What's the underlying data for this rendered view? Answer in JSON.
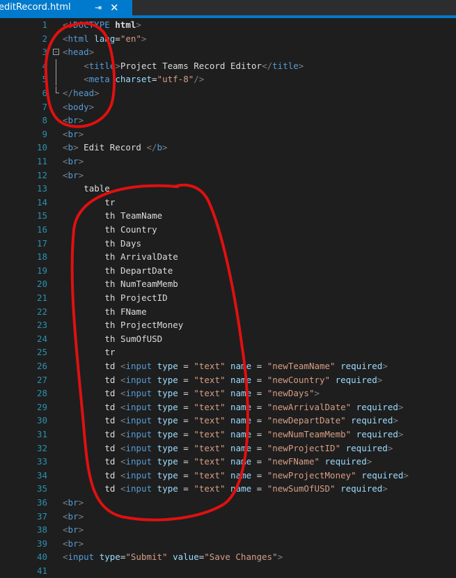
{
  "tab": {
    "title": "editRecord.html",
    "pin": "⇥",
    "close": "✕"
  },
  "lines": [
    {
      "n": "1",
      "indent": 0,
      "parts": [
        {
          "t": "<!",
          "c": "br"
        },
        {
          "t": "DOCTYPE ",
          "c": "tag"
        },
        {
          "t": "html",
          "c": "txt bold"
        },
        {
          "t": ">",
          "c": "br"
        }
      ]
    },
    {
      "n": "2",
      "indent": 0,
      "parts": [
        {
          "t": "<",
          "c": "br"
        },
        {
          "t": "html",
          "c": "tag"
        },
        {
          "t": " lang",
          "c": "attr"
        },
        {
          "t": "=",
          "c": "txt"
        },
        {
          "t": "\"en\"",
          "c": "val"
        },
        {
          "t": ">",
          "c": "br"
        }
      ]
    },
    {
      "n": "3",
      "indent": 0,
      "fold": "minus",
      "parts": [
        {
          "t": "<",
          "c": "br"
        },
        {
          "t": "head",
          "c": "tag"
        },
        {
          "t": ">",
          "c": "br"
        }
      ]
    },
    {
      "n": "4",
      "indent": 4,
      "foldline": true,
      "parts": [
        {
          "t": "<",
          "c": "br"
        },
        {
          "t": "title",
          "c": "tag"
        },
        {
          "t": ">",
          "c": "br"
        },
        {
          "t": "Project Teams Record Editor",
          "c": "txt"
        },
        {
          "t": "</",
          "c": "br"
        },
        {
          "t": "title",
          "c": "tag"
        },
        {
          "t": ">",
          "c": "br"
        }
      ]
    },
    {
      "n": "5",
      "indent": 4,
      "foldline": true,
      "parts": [
        {
          "t": "<",
          "c": "br"
        },
        {
          "t": "meta",
          "c": "tag"
        },
        {
          "t": " charset",
          "c": "attr"
        },
        {
          "t": "=",
          "c": "txt"
        },
        {
          "t": "\"utf-8\"",
          "c": "val"
        },
        {
          "t": "/>",
          "c": "br"
        }
      ]
    },
    {
      "n": "6",
      "indent": 0,
      "foldend": true,
      "parts": [
        {
          "t": "</",
          "c": "br"
        },
        {
          "t": "head",
          "c": "tag"
        },
        {
          "t": ">",
          "c": "br"
        }
      ]
    },
    {
      "n": "7",
      "indent": 0,
      "parts": [
        {
          "t": "<",
          "c": "br"
        },
        {
          "t": "body",
          "c": "tag"
        },
        {
          "t": ">",
          "c": "br"
        }
      ]
    },
    {
      "n": "8",
      "indent": 0,
      "parts": [
        {
          "t": "<",
          "c": "br"
        },
        {
          "t": "br",
          "c": "tag"
        },
        {
          "t": ">",
          "c": "br"
        }
      ]
    },
    {
      "n": "9",
      "indent": 0,
      "parts": [
        {
          "t": "<",
          "c": "br"
        },
        {
          "t": "br",
          "c": "tag"
        },
        {
          "t": ">",
          "c": "br"
        }
      ]
    },
    {
      "n": "10",
      "indent": 0,
      "parts": [
        {
          "t": "<",
          "c": "br"
        },
        {
          "t": "b",
          "c": "tag"
        },
        {
          "t": ">",
          "c": "br"
        },
        {
          "t": " Edit Record ",
          "c": "txt"
        },
        {
          "t": "</",
          "c": "br"
        },
        {
          "t": "b",
          "c": "tag"
        },
        {
          "t": ">",
          "c": "br"
        }
      ]
    },
    {
      "n": "11",
      "indent": 0,
      "parts": [
        {
          "t": "<",
          "c": "br"
        },
        {
          "t": "br",
          "c": "tag"
        },
        {
          "t": ">",
          "c": "br"
        }
      ]
    },
    {
      "n": "12",
      "indent": 0,
      "parts": [
        {
          "t": "<",
          "c": "br"
        },
        {
          "t": "br",
          "c": "tag"
        },
        {
          "t": ">",
          "c": "br"
        }
      ]
    },
    {
      "n": "13",
      "indent": 4,
      "parts": [
        {
          "t": "table",
          "c": "txt"
        }
      ]
    },
    {
      "n": "14",
      "indent": 8,
      "parts": [
        {
          "t": "tr",
          "c": "txt"
        }
      ]
    },
    {
      "n": "15",
      "indent": 8,
      "parts": [
        {
          "t": "th TeamName",
          "c": "txt"
        }
      ]
    },
    {
      "n": "16",
      "indent": 8,
      "parts": [
        {
          "t": "th Country",
          "c": "txt"
        }
      ]
    },
    {
      "n": "17",
      "indent": 8,
      "parts": [
        {
          "t": "th Days",
          "c": "txt"
        }
      ]
    },
    {
      "n": "18",
      "indent": 8,
      "parts": [
        {
          "t": "th ArrivalDate",
          "c": "txt"
        }
      ]
    },
    {
      "n": "19",
      "indent": 8,
      "parts": [
        {
          "t": "th DepartDate",
          "c": "txt"
        }
      ]
    },
    {
      "n": "20",
      "indent": 8,
      "parts": [
        {
          "t": "th NumTeamMemb",
          "c": "txt"
        }
      ]
    },
    {
      "n": "21",
      "indent": 8,
      "parts": [
        {
          "t": "th ProjectID",
          "c": "txt"
        }
      ]
    },
    {
      "n": "22",
      "indent": 8,
      "parts": [
        {
          "t": "th FName",
          "c": "txt"
        }
      ]
    },
    {
      "n": "23",
      "indent": 8,
      "parts": [
        {
          "t": "th ProjectMoney",
          "c": "txt"
        }
      ]
    },
    {
      "n": "24",
      "indent": 8,
      "parts": [
        {
          "t": "th SumOfUSD",
          "c": "txt"
        }
      ]
    },
    {
      "n": "25",
      "indent": 8,
      "parts": [
        {
          "t": "tr",
          "c": "txt"
        }
      ]
    },
    {
      "n": "26",
      "indent": 8,
      "parts": [
        {
          "t": "td ",
          "c": "txt"
        },
        {
          "t": "<",
          "c": "br"
        },
        {
          "t": "input",
          "c": "tag"
        },
        {
          "t": " type",
          "c": "attr"
        },
        {
          "t": " = ",
          "c": "txt"
        },
        {
          "t": "\"text\"",
          "c": "val"
        },
        {
          "t": " name",
          "c": "attr"
        },
        {
          "t": " = ",
          "c": "txt"
        },
        {
          "t": "\"newTeamName\"",
          "c": "val"
        },
        {
          "t": " required",
          "c": "attr"
        },
        {
          "t": ">",
          "c": "br"
        }
      ]
    },
    {
      "n": "27",
      "indent": 8,
      "parts": [
        {
          "t": "td ",
          "c": "txt"
        },
        {
          "t": "<",
          "c": "br"
        },
        {
          "t": "input",
          "c": "tag"
        },
        {
          "t": " type",
          "c": "attr"
        },
        {
          "t": " = ",
          "c": "txt"
        },
        {
          "t": "\"text\"",
          "c": "val"
        },
        {
          "t": " name",
          "c": "attr"
        },
        {
          "t": " = ",
          "c": "txt"
        },
        {
          "t": "\"newCountry\"",
          "c": "val"
        },
        {
          "t": " required",
          "c": "attr"
        },
        {
          "t": ">",
          "c": "br"
        }
      ]
    },
    {
      "n": "28",
      "indent": 8,
      "parts": [
        {
          "t": "td ",
          "c": "txt"
        },
        {
          "t": "<",
          "c": "br"
        },
        {
          "t": "input",
          "c": "tag"
        },
        {
          "t": " type",
          "c": "attr"
        },
        {
          "t": " = ",
          "c": "txt"
        },
        {
          "t": "\"text\"",
          "c": "val"
        },
        {
          "t": " name",
          "c": "attr"
        },
        {
          "t": " = ",
          "c": "txt"
        },
        {
          "t": "\"newDays\"",
          "c": "val"
        },
        {
          "t": ">",
          "c": "br"
        }
      ]
    },
    {
      "n": "29",
      "indent": 8,
      "parts": [
        {
          "t": "td ",
          "c": "txt"
        },
        {
          "t": "<",
          "c": "br"
        },
        {
          "t": "input",
          "c": "tag"
        },
        {
          "t": " type",
          "c": "attr"
        },
        {
          "t": " = ",
          "c": "txt"
        },
        {
          "t": "\"text\"",
          "c": "val"
        },
        {
          "t": " name",
          "c": "attr"
        },
        {
          "t": " = ",
          "c": "txt"
        },
        {
          "t": "\"newArrivalDate\"",
          "c": "val"
        },
        {
          "t": " required",
          "c": "attr"
        },
        {
          "t": ">",
          "c": "br"
        }
      ]
    },
    {
      "n": "30",
      "indent": 8,
      "parts": [
        {
          "t": "td ",
          "c": "txt"
        },
        {
          "t": "<",
          "c": "br"
        },
        {
          "t": "input",
          "c": "tag"
        },
        {
          "t": " type",
          "c": "attr"
        },
        {
          "t": " = ",
          "c": "txt"
        },
        {
          "t": "\"text\"",
          "c": "val"
        },
        {
          "t": " name",
          "c": "attr"
        },
        {
          "t": " = ",
          "c": "txt"
        },
        {
          "t": "\"newDepartDate\"",
          "c": "val"
        },
        {
          "t": " required",
          "c": "attr"
        },
        {
          "t": ">",
          "c": "br"
        }
      ]
    },
    {
      "n": "31",
      "indent": 8,
      "parts": [
        {
          "t": "td ",
          "c": "txt"
        },
        {
          "t": "<",
          "c": "br"
        },
        {
          "t": "input",
          "c": "tag"
        },
        {
          "t": " type",
          "c": "attr"
        },
        {
          "t": " = ",
          "c": "txt"
        },
        {
          "t": "\"text\"",
          "c": "val"
        },
        {
          "t": " name",
          "c": "attr"
        },
        {
          "t": " = ",
          "c": "txt"
        },
        {
          "t": "\"newNumTeamMemb\"",
          "c": "val"
        },
        {
          "t": " required",
          "c": "attr"
        },
        {
          "t": ">",
          "c": "br"
        }
      ]
    },
    {
      "n": "32",
      "indent": 8,
      "parts": [
        {
          "t": "td ",
          "c": "txt"
        },
        {
          "t": "<",
          "c": "br"
        },
        {
          "t": "input",
          "c": "tag"
        },
        {
          "t": " type",
          "c": "attr"
        },
        {
          "t": " = ",
          "c": "txt"
        },
        {
          "t": "\"text\"",
          "c": "val"
        },
        {
          "t": " name",
          "c": "attr"
        },
        {
          "t": " = ",
          "c": "txt"
        },
        {
          "t": "\"newProjectID\"",
          "c": "val"
        },
        {
          "t": " required",
          "c": "attr"
        },
        {
          "t": ">",
          "c": "br"
        }
      ]
    },
    {
      "n": "33",
      "indent": 8,
      "parts": [
        {
          "t": "td ",
          "c": "txt"
        },
        {
          "t": "<",
          "c": "br"
        },
        {
          "t": "input",
          "c": "tag"
        },
        {
          "t": " type",
          "c": "attr"
        },
        {
          "t": " = ",
          "c": "txt"
        },
        {
          "t": "\"text\"",
          "c": "val"
        },
        {
          "t": " name",
          "c": "attr"
        },
        {
          "t": " = ",
          "c": "txt"
        },
        {
          "t": "\"newFName\"",
          "c": "val"
        },
        {
          "t": " required",
          "c": "attr"
        },
        {
          "t": ">",
          "c": "br"
        }
      ]
    },
    {
      "n": "34",
      "indent": 8,
      "parts": [
        {
          "t": "td ",
          "c": "txt"
        },
        {
          "t": "<",
          "c": "br"
        },
        {
          "t": "input",
          "c": "tag"
        },
        {
          "t": " type",
          "c": "attr"
        },
        {
          "t": " = ",
          "c": "txt"
        },
        {
          "t": "\"text\"",
          "c": "val"
        },
        {
          "t": " name",
          "c": "attr"
        },
        {
          "t": " = ",
          "c": "txt"
        },
        {
          "t": "\"newProjectMoney\"",
          "c": "val"
        },
        {
          "t": " required",
          "c": "attr"
        },
        {
          "t": ">",
          "c": "br"
        }
      ]
    },
    {
      "n": "35",
      "indent": 8,
      "parts": [
        {
          "t": "td ",
          "c": "txt"
        },
        {
          "t": "<",
          "c": "br"
        },
        {
          "t": "input",
          "c": "tag"
        },
        {
          "t": " type",
          "c": "attr"
        },
        {
          "t": " = ",
          "c": "txt"
        },
        {
          "t": "\"text\"",
          "c": "val"
        },
        {
          "t": " name",
          "c": "attr"
        },
        {
          "t": " = ",
          "c": "txt"
        },
        {
          "t": "\"newSumOfUSD\"",
          "c": "val"
        },
        {
          "t": " required",
          "c": "attr"
        },
        {
          "t": ">",
          "c": "br"
        }
      ]
    },
    {
      "n": "36",
      "indent": 0,
      "parts": [
        {
          "t": "<",
          "c": "br"
        },
        {
          "t": "br",
          "c": "tag"
        },
        {
          "t": ">",
          "c": "br"
        }
      ]
    },
    {
      "n": "37",
      "indent": 0,
      "parts": [
        {
          "t": "<",
          "c": "br"
        },
        {
          "t": "br",
          "c": "tag"
        },
        {
          "t": ">",
          "c": "br"
        }
      ]
    },
    {
      "n": "38",
      "indent": 0,
      "parts": [
        {
          "t": "<",
          "c": "br"
        },
        {
          "t": "br",
          "c": "tag"
        },
        {
          "t": ">",
          "c": "br"
        }
      ]
    },
    {
      "n": "39",
      "indent": 0,
      "parts": [
        {
          "t": "<",
          "c": "br"
        },
        {
          "t": "br",
          "c": "tag"
        },
        {
          "t": ">",
          "c": "br"
        }
      ]
    },
    {
      "n": "40",
      "indent": 0,
      "parts": [
        {
          "t": "<",
          "c": "br"
        },
        {
          "t": "input",
          "c": "tag"
        },
        {
          "t": " type",
          "c": "attr"
        },
        {
          "t": "=",
          "c": "txt"
        },
        {
          "t": "\"Submit\"",
          "c": "val"
        },
        {
          "t": " value",
          "c": "attr"
        },
        {
          "t": "=",
          "c": "txt"
        },
        {
          "t": "\"Save Changes\"",
          "c": "val"
        },
        {
          "t": ">",
          "c": "br"
        }
      ]
    },
    {
      "n": "41",
      "indent": 0,
      "parts": []
    }
  ],
  "colors": {
    "background": "#1e1e1e",
    "line_number": "#2b91af",
    "tag": "#569cd6",
    "attribute": "#9cdcfe",
    "value": "#d69d85",
    "delimiter": "#808080",
    "text": "#dcdcdc",
    "tab_active": "#007acc",
    "annotation": "#e01010"
  }
}
